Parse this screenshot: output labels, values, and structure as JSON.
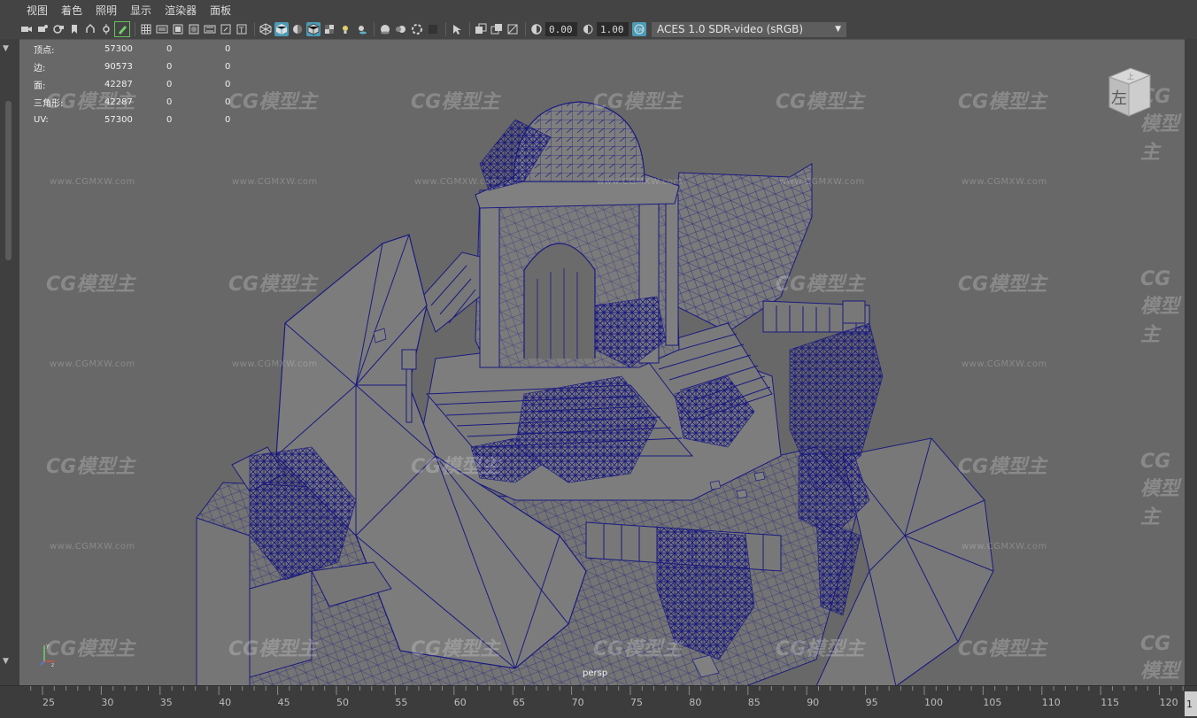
{
  "menubar": {
    "items": [
      "视图",
      "着色",
      "照明",
      "显示",
      "渲染器",
      "面板"
    ]
  },
  "toolbar": {
    "gamma": "0.00",
    "exposure": "1.00",
    "colorspace": "ACES 1.0 SDR-video (sRGB)",
    "icons": [
      "camera-icon",
      "camera-attributes-icon",
      "bookmark-icon",
      "image-plane-icon",
      "2d-pan-icon",
      "grease-pencil-icon",
      "grid-icon",
      "film-gate-icon",
      "resolution-gate-icon",
      "gate-mask-icon",
      "field-chart-icon",
      "safe-action-icon",
      "safe-title-icon",
      "wireframe-icon",
      "smooth-shade-icon",
      "use-default-material-icon",
      "wireframe-on-shaded-icon",
      "textured-icon",
      "use-all-lights-icon",
      "shadows-icon",
      "screen-space-ao-icon",
      "motion-blur-icon",
      "multisample-aa-icon",
      "depth-of-field-icon",
      "isolate-select-icon",
      "xray-icon",
      "xray-joints-icon",
      "xray-components-icon",
      "gamma-icon",
      "exposure-icon",
      "color-management-icon"
    ]
  },
  "hud": {
    "rows": [
      {
        "label": "顶点:",
        "v1": "57300",
        "v2": "0",
        "v3": "0"
      },
      {
        "label": "边:",
        "v1": "90573",
        "v2": "0",
        "v3": "0"
      },
      {
        "label": "面:",
        "v1": "42287",
        "v2": "0",
        "v3": "0"
      },
      {
        "label": "三角形:",
        "v1": "42287",
        "v2": "0",
        "v3": "0"
      },
      {
        "label": "UV:",
        "v1": "57300",
        "v2": "0",
        "v3": "0"
      }
    ]
  },
  "viewport": {
    "camera": "persp",
    "view_cube_label": "左",
    "view_cube_top": "上"
  },
  "watermark": {
    "logo": "CG模型主",
    "url": "www.CGMXW.com"
  },
  "timeline": {
    "ticks": [
      "25",
      "30",
      "35",
      "40",
      "45",
      "50",
      "55",
      "60",
      "65",
      "70",
      "75",
      "80",
      "85",
      "90",
      "95",
      "100",
      "105",
      "110",
      "115",
      "120"
    ],
    "current_frame": "1"
  },
  "colors": {
    "viewport_bg": "#686868",
    "wireframe": "#1a1a80",
    "ui_bg": "#444444",
    "active_icon": "#4b9bb5"
  }
}
